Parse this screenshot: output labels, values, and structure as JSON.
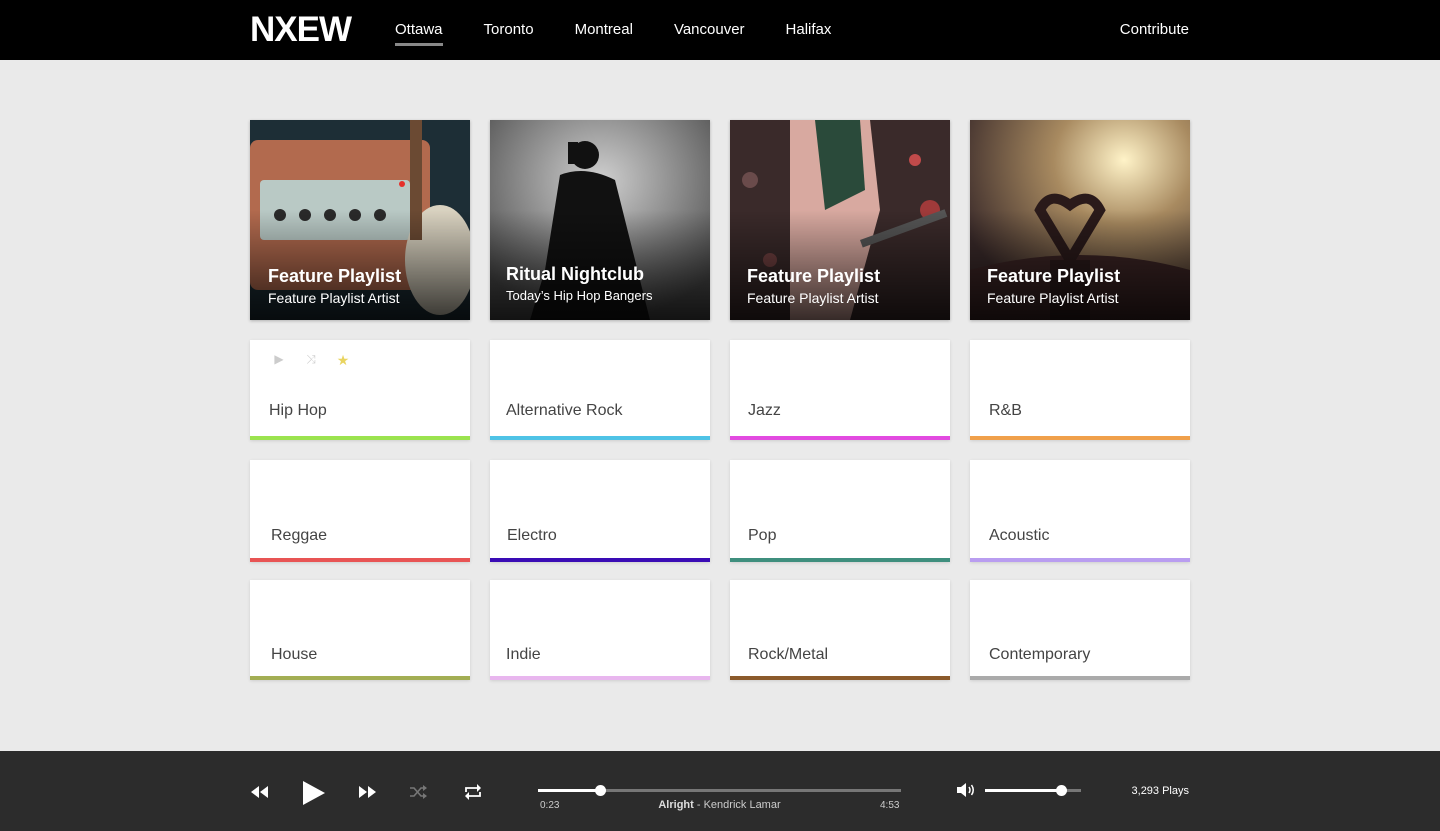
{
  "brand": {
    "logo": "NXEW"
  },
  "nav": {
    "items": [
      {
        "label": "Ottawa",
        "active": true
      },
      {
        "label": "Toronto"
      },
      {
        "label": "Montreal"
      },
      {
        "label": "Vancouver"
      },
      {
        "label": "Halifax"
      }
    ],
    "contribute": "Contribute"
  },
  "features": [
    {
      "title": "Feature Playlist",
      "subtitle": "Feature Playlist Artist",
      "image": "amplifier-guitar"
    },
    {
      "title": "Ritual Nightclub",
      "subtitle": "Today’s Hip Hop Bangers",
      "image": "rapper-silhouette"
    },
    {
      "title": "Feature Playlist",
      "subtitle": "Feature Playlist Artist",
      "image": "guitarist-stage"
    },
    {
      "title": "Feature Playlist",
      "subtitle": "Feature Playlist Artist",
      "image": "concert-heart-hands"
    }
  ],
  "genre_controls": [
    "play-icon",
    "shuffle-icon",
    "star-icon"
  ],
  "genres": [
    {
      "label": "Hip Hop",
      "color": "#9be34f"
    },
    {
      "label": "Alternative Rock",
      "color": "#4fc3e6"
    },
    {
      "label": "Jazz",
      "color": "#e24be0"
    },
    {
      "label": "R&B",
      "color": "#f0a04b"
    },
    {
      "label": "Reggae",
      "color": "#e85454"
    },
    {
      "label": "Electro",
      "color": "#3a0cb5"
    },
    {
      "label": "Pop",
      "color": "#3f8f7e"
    },
    {
      "label": "Acoustic",
      "color": "#b99df0"
    },
    {
      "label": "House",
      "color": "#a3ae54"
    },
    {
      "label": "Indie",
      "color": "#e8b6ee"
    },
    {
      "label": "Rock/Metal",
      "color": "#8b5a2b"
    },
    {
      "label": "Contemporary",
      "color": "#aaaaaa"
    }
  ],
  "player": {
    "elapsed": "0:23",
    "duration": "4:53",
    "track": "Alright",
    "separator": " - ",
    "artist": "Kendrick Lamar",
    "progress": 0.17,
    "volume": 0.79,
    "plays": "3,293 Plays"
  }
}
